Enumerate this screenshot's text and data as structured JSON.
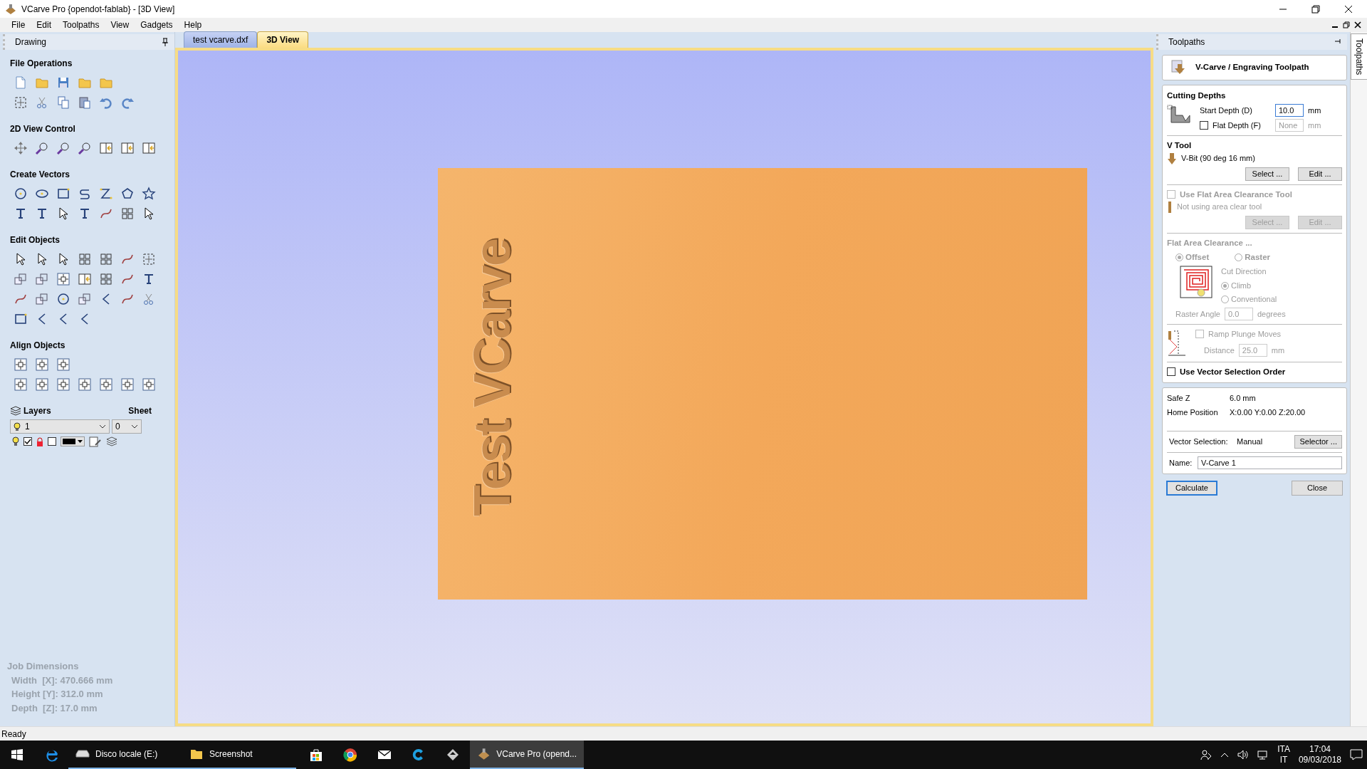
{
  "window": {
    "title": "VCarve Pro {opendot-fablab} - [3D View]"
  },
  "menu": [
    "File",
    "Edit",
    "Toolpaths",
    "View",
    "Gadgets",
    "Help"
  ],
  "drawing_panel": {
    "title": "Drawing",
    "sections": [
      {
        "heading": "File Operations"
      },
      {
        "heading": "2D View Control"
      },
      {
        "heading": "Create Vectors"
      },
      {
        "heading": "Edit Objects"
      },
      {
        "heading": "Align Objects"
      }
    ],
    "layers": {
      "heading": "Layers",
      "layer": "1",
      "sheet_heading": "Sheet",
      "sheet": "0",
      "checked": true
    },
    "job_dimensions": {
      "heading": "Job Dimensions",
      "lines": [
        "Width  [X]: 470.666 mm",
        "Height [Y]: 312.0 mm",
        "Depth  [Z]: 17.0 mm"
      ]
    }
  },
  "tabs": [
    {
      "label": "test vcarve.dxf",
      "selected": false
    },
    {
      "label": "3D View",
      "selected": true
    }
  ],
  "view": {
    "engraving": "Test VCarve"
  },
  "toolpaths_panel": {
    "title": "Toolpaths",
    "side_tab": "Toolpaths",
    "heading": "V-Carve / Engraving Toolpath",
    "cutting_depths": {
      "heading": "Cutting Depths",
      "start_label": "Start Depth (D)",
      "start_value": "10.0",
      "start_unit": "mm",
      "flat_label": "Flat Depth (F)",
      "flat_checked": false,
      "flat_value": "None",
      "flat_unit": "mm"
    },
    "v_tool": {
      "heading": "V Tool",
      "tool": "V-Bit (90 deg 16 mm)",
      "buttons": [
        "Select ...",
        "Edit ..."
      ]
    },
    "flat_tool": {
      "label": "Use Flat Area Clearance Tool",
      "checked": false,
      "note": "Not using area clear tool",
      "buttons": [
        "Select ...",
        "Edit ..."
      ]
    },
    "clearance": {
      "heading": "Flat Area Clearance ...",
      "strategies": [
        {
          "label": "Offset",
          "selected": true
        },
        {
          "label": "Raster",
          "selected": false
        }
      ],
      "cut_direction": "Cut Direction",
      "directions": [
        {
          "label": "Climb",
          "selected": true
        },
        {
          "label": "Conventional",
          "selected": false
        }
      ],
      "angle_label": "Raster Angle",
      "angle_value": "0.0",
      "angle_unit": "degrees"
    },
    "ramp": {
      "label": "Ramp Plunge Moves",
      "checked": false,
      "distance_label": "Distance",
      "distance_value": "25.0",
      "distance_unit": "mm"
    },
    "vector_order": {
      "label": "Use Vector Selection Order",
      "checked": false
    },
    "info": [
      {
        "label": "Safe Z",
        "value": "6.0 mm"
      },
      {
        "label": "Home Position",
        "value": "X:0.00 Y:0.00 Z:20.00"
      }
    ],
    "vector_selection": {
      "label": "Vector Selection:",
      "value": "Manual",
      "button": "Selector ..."
    },
    "name": {
      "label": "Name:",
      "value": "V-Carve 1"
    },
    "buttons": [
      "Calculate",
      "Close"
    ]
  },
  "status_bar": {
    "text": "Ready"
  },
  "taskbar": {
    "windows": [
      {
        "label": "Disco locale (E:)",
        "selected": false
      },
      {
        "label": "Screenshot",
        "selected": false
      },
      {
        "label": "VCarve Pro (opend...",
        "selected": true
      }
    ],
    "language": [
      "ITA",
      "IT"
    ],
    "time": "17:04",
    "date": "09/03/2018"
  }
}
